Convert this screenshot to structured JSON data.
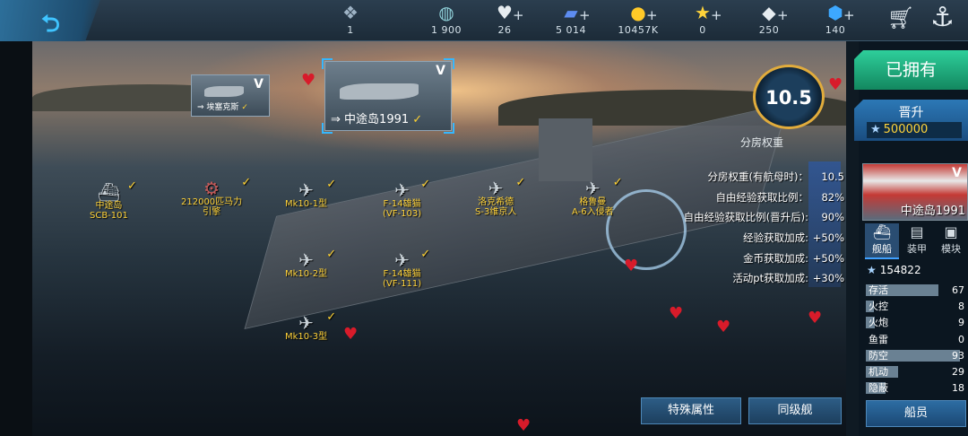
{
  "topbar": {
    "back_icon": "back-arrow-icon",
    "resources": [
      {
        "icon": "rank-chevron-icon",
        "value": "1",
        "plus": false
      },
      {
        "icon": "globe-icon",
        "value": "1 900",
        "plus": false
      },
      {
        "icon": "heart-icon",
        "value": "26",
        "plus": true
      },
      {
        "icon": "card-icon",
        "value": "5 014",
        "plus": true
      },
      {
        "icon": "gold-coin-icon",
        "value": "10457K",
        "plus": true
      },
      {
        "icon": "star-icon",
        "value": "0",
        "plus": true
      },
      {
        "icon": "diamond-icon",
        "value": "250",
        "plus": true
      },
      {
        "icon": "crystal-icon",
        "value": "140",
        "plus": true
      }
    ],
    "plus_sign": "+"
  },
  "cards": {
    "card1": {
      "name": "埃塞克斯",
      "rank": "V",
      "check": "✓"
    },
    "card2": {
      "name": "中途岛1991",
      "rank": "V",
      "check": "✓"
    }
  },
  "fleet": [
    {
      "line1": "中途岛",
      "line2": "SCB-101"
    },
    {
      "line1": "212000匹马力",
      "line2": "引擎"
    },
    {
      "line1": "Mk10-1型",
      "line2": ""
    },
    {
      "line1": "F-14雄猫",
      "line2": "(VF-103)"
    },
    {
      "line1": "洛克希德",
      "line2": "S-3维京人"
    },
    {
      "line1": "格鲁曼",
      "line2": "A-6入侵者"
    },
    {
      "line1": "Mk10-2型",
      "line2": ""
    },
    {
      "line1": "F-14雄猫",
      "line2": "(VF-111)"
    },
    {
      "line1": "Mk10-3型",
      "line2": ""
    }
  ],
  "weight": {
    "value": "10.5",
    "label": "分房权重"
  },
  "stats": [
    {
      "label": "分房权重(有航母时)：",
      "value": "10.5"
    },
    {
      "label": "自由经验获取比例：",
      "value": "82%"
    },
    {
      "label": "自由经验获取比例(晋升后):",
      "value": "90%"
    },
    {
      "label": "经验获取加成:",
      "value": "+50%"
    },
    {
      "label": "金币获取加成:",
      "value": "+50%"
    },
    {
      "label": "活动pt获取加成:",
      "value": "+30%"
    }
  ],
  "buttons": {
    "special": "特殊属性",
    "same_class": "同级舰",
    "crew": "船员"
  },
  "panel": {
    "owned": "已拥有",
    "promote": "晋升",
    "promote_cost": "500000",
    "ship_name": "中途岛1991",
    "ship_rank": "V",
    "tabs": [
      {
        "icon": "ship-icon",
        "label": "舰船"
      },
      {
        "icon": "armor-icon",
        "label": "装甲"
      },
      {
        "icon": "module-icon",
        "label": "模块"
      }
    ],
    "power": "154822",
    "attributes": [
      {
        "name": "存活",
        "value": "67",
        "fill": 0.72
      },
      {
        "name": "火控",
        "value": "8",
        "fill": 0.08
      },
      {
        "name": "火炮",
        "value": "9",
        "fill": 0.09
      },
      {
        "name": "鱼雷",
        "value": "0",
        "fill": 0.0
      },
      {
        "name": "防空",
        "value": "93",
        "fill": 0.94
      },
      {
        "name": "机动",
        "value": "29",
        "fill": 0.32
      },
      {
        "name": "隐蔽",
        "value": "18",
        "fill": 0.2
      }
    ]
  },
  "colors": {
    "accent": "#35b7ff",
    "gold": "#ffd33a",
    "owned": "#1fb07f",
    "heart": "#d81b2a"
  }
}
